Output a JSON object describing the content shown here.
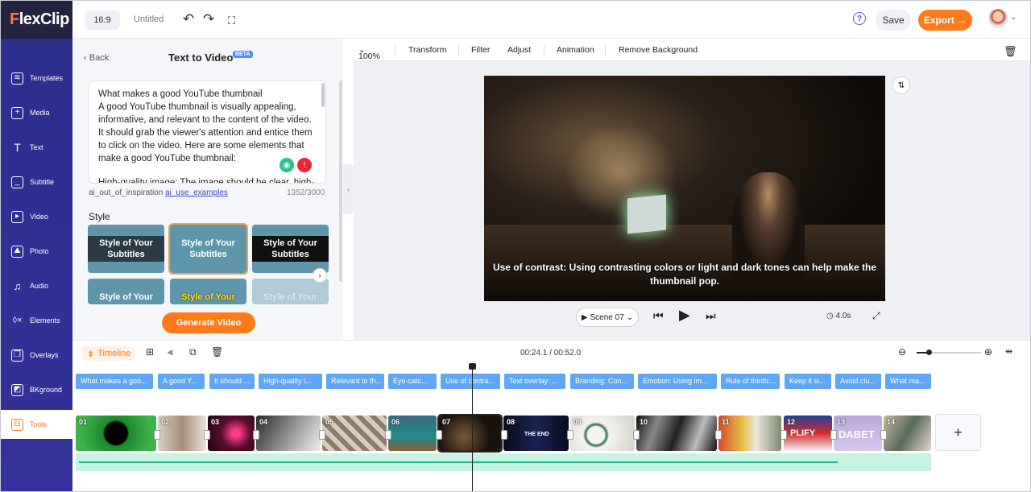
{
  "app": {
    "logo": "FlexClip",
    "aspect": "16:9",
    "title": "Untitled",
    "save": "Save",
    "export": "Export →"
  },
  "sidebar": {
    "items": [
      {
        "label": "Templates",
        "icon": "layers-icon"
      },
      {
        "label": "Media",
        "icon": "media-icon"
      },
      {
        "label": "Text",
        "icon": "text-icon"
      },
      {
        "label": "Subtitle",
        "icon": "subtitle-icon"
      },
      {
        "label": "Video",
        "icon": "video-icon"
      },
      {
        "label": "Photo",
        "icon": "photo-icon"
      },
      {
        "label": "Audio",
        "icon": "audio-icon"
      },
      {
        "label": "Elements",
        "icon": "elements-icon"
      },
      {
        "label": "Overlays",
        "icon": "overlays-icon"
      },
      {
        "label": "BKground",
        "icon": "background-icon"
      },
      {
        "label": "Tools",
        "icon": "tools-icon",
        "active": true
      }
    ]
  },
  "panel": {
    "back": "Back",
    "title": "Text to Video",
    "badge": "BETA",
    "text_lines": [
      "What makes a good YouTube thumbnail",
      "A good YouTube thumbnail is visually appealing, informative, and relevant to the content of the video. It should grab the viewer's attention and entice them to click on the video. Here are some elements that make a good YouTube thumbnail:",
      "High-quality image: The image should be clear, high-"
    ],
    "inspiration_prefix": "ai_out_of_inspiration",
    "inspiration_link": "ai_use_examples",
    "char_count": "1352/3000",
    "style_label": "Style",
    "style_cards": [
      "Style of Your Subtitles",
      "Style of Your Subtitles",
      "Style of Your Subtitles",
      "Style of Your",
      "Style of Your",
      "Style of Your"
    ],
    "generate": "Generate Video"
  },
  "editor": {
    "zoom": "100%",
    "tools": [
      "Transform",
      "Filter",
      "Adjust",
      "Animation",
      "Remove Background"
    ],
    "caption": "Use of contrast: Using contrasting colors or light and dark tones can help make the thumbnail pop.",
    "scene": "Scene 07",
    "duration": "4.0s"
  },
  "timeline": {
    "label": "Timeline",
    "time": "00:24.1 / 00:52.0",
    "subtitles": [
      "What makes a goo...",
      "A good Y...",
      "It should ...",
      "High-quality i...",
      "Relevant to th...",
      "Eye-catc...",
      "Use of contra...",
      "Text overlay: ...",
      "Branding: Con...",
      "Emotion: Using im...",
      "Rule of thirds:...",
      "Keep it si...",
      "Avoid clu...",
      "What ma..."
    ],
    "clips": [
      "01",
      "02",
      "03",
      "04",
      "05",
      "06",
      "07",
      "08",
      "09",
      "10",
      "11",
      "12",
      "13",
      "14"
    ],
    "clip_texts": {
      "08": "THE END",
      "12": "PLIFY",
      "13": "DABET"
    }
  },
  "colors": {
    "accent": "#ff7a1a",
    "sidebar": "#2c2e8c",
    "subtitle_chip": "#5fa6f5",
    "audio": "#c7f3e3"
  }
}
